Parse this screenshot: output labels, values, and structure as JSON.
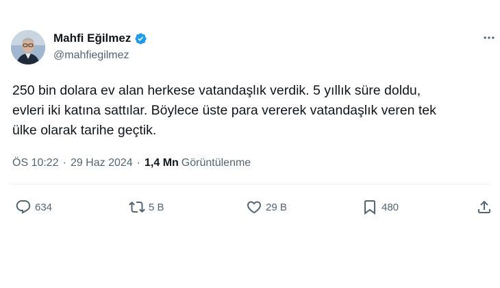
{
  "author": {
    "name": "Mahfi Eğilmez",
    "handle": "@mahfiegilmez",
    "verified": true,
    "verified_color": "#1d9bf0"
  },
  "tweet": {
    "text_lines": [
      "250 bin dolara ev alan herkese vatandaşlık verdik. 5 yıllık süre doldu,",
      "evleri iki katına sattılar. Böylece üste para vererek vatandaşlık veren tek",
      "ülke olarak tarihe geçtik."
    ],
    "time": "ÖS 10:22",
    "date": "29 Haz 2024",
    "views": "1,4 Mn",
    "views_label": "Görüntülenme",
    "separator": "·"
  },
  "actions": {
    "replies": "634",
    "retweets": "5 B",
    "likes": "29 B",
    "bookmarks": "480"
  },
  "icons": {
    "more": "more-horizontal-icon",
    "reply": "reply-icon",
    "retweet": "retweet-icon",
    "like": "heart-icon",
    "bookmark": "bookmark-icon",
    "share": "share-icon",
    "verified": "verified-badge-icon"
  },
  "colors": {
    "text_primary": "#0f1419",
    "text_secondary": "#536471",
    "accent": "#1d9bf0"
  }
}
